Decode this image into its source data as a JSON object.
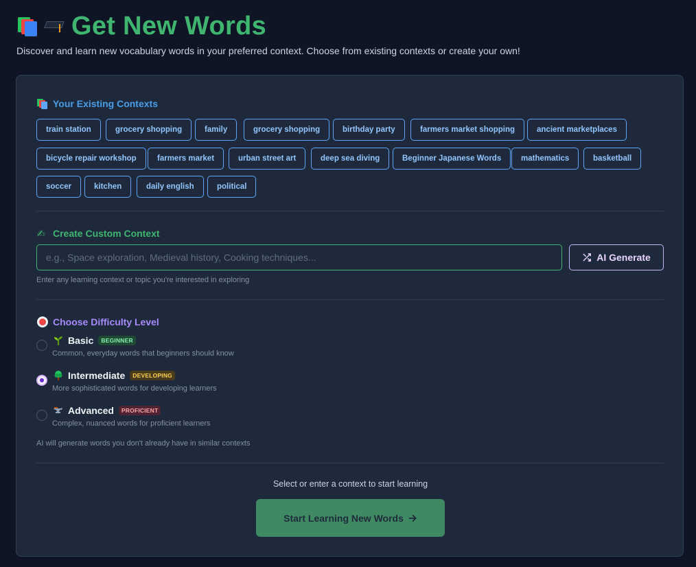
{
  "header": {
    "title": "Get New Words",
    "subtitle": "Discover and learn new vocabulary words in your preferred context. Choose from existing contexts or create your own!",
    "icons": [
      "books-icon",
      "graduation-cap-icon"
    ]
  },
  "contexts": {
    "label": "Your Existing Contexts",
    "items": [
      "train station",
      "grocery shopping",
      "family",
      "grocery shopping",
      "birthday party",
      "farmers market shopping",
      "ancient marketplaces",
      "bicycle repair workshop",
      "farmers market",
      "urban street art",
      "deep sea diving",
      "Beginner Japanese Words",
      "mathematics",
      "basketball",
      "soccer",
      "kitchen",
      "daily english",
      "political"
    ]
  },
  "custom": {
    "label": "Create Custom Context",
    "placeholder": "e.g., Space exploration, Medieval history, Cooking techniques...",
    "value": "",
    "ai_button": "AI Generate",
    "hint": "Enter any learning context or topic you're interested in exploring"
  },
  "difficulty": {
    "label": "Choose Difficulty Level",
    "selected": "intermediate",
    "options": [
      {
        "id": "basic",
        "name": "Basic",
        "badge": "BEGINNER",
        "description": "Common, everyday words that beginners should know",
        "icon": "seedling-icon"
      },
      {
        "id": "intermediate",
        "name": "Intermediate",
        "badge": "DEVELOPING",
        "description": "More sophisticated words for developing learners",
        "icon": "tree-icon"
      },
      {
        "id": "advanced",
        "name": "Advanced",
        "badge": "PROFICIENT",
        "description": "Complex, nuanced words for proficient learners",
        "icon": "anvil-icon"
      }
    ],
    "note": "AI will generate words you don't already have in similar contexts"
  },
  "cta": {
    "prompt": "Select or enter a context to start learning",
    "button": "Start Learning New Words"
  },
  "colors": {
    "background": "#0f1525",
    "card": "#1e2a3c",
    "title_green": "#3fb56f",
    "contexts_blue": "#4a9ee8",
    "difficulty_purple": "#a78bfa",
    "cta_button": "#3f8a62"
  }
}
